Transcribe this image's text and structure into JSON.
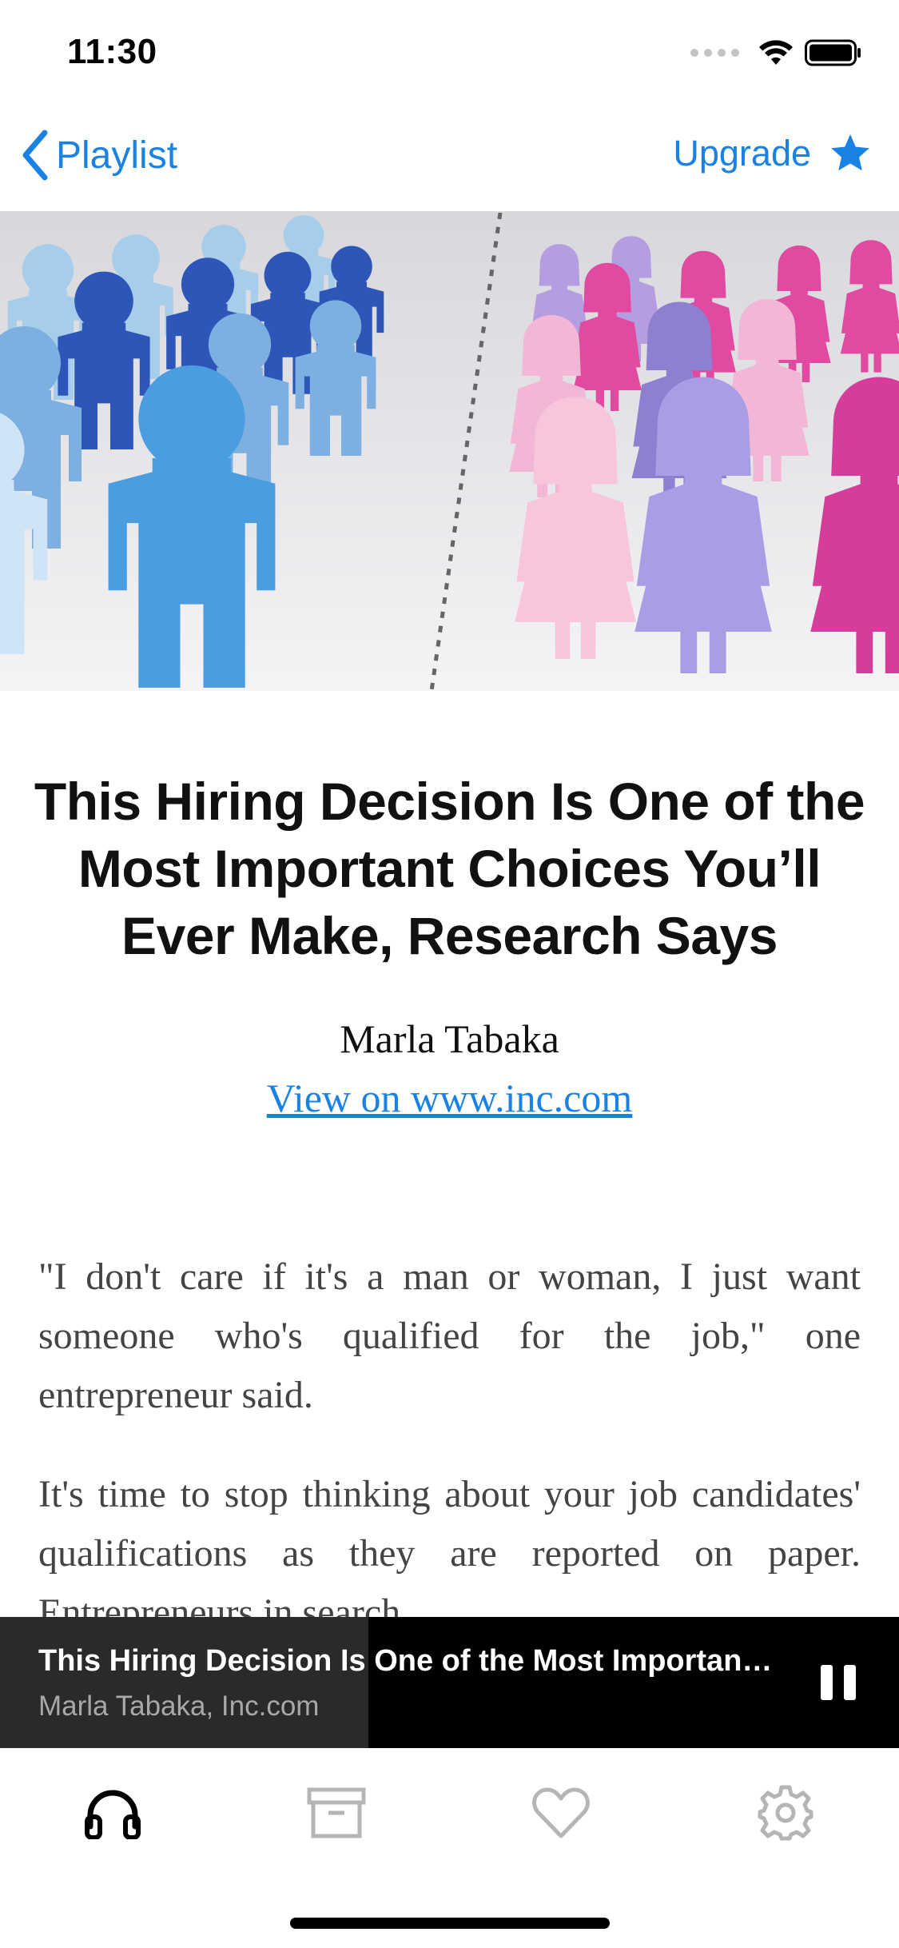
{
  "status_bar": {
    "time": "11:30"
  },
  "nav": {
    "back_label": "Playlist",
    "upgrade_label": "Upgrade"
  },
  "article": {
    "title": "This Hiring Decision Is One of the Most Important Choices You’ll Ever Make, Research Says",
    "author": "Marla Tabaka",
    "source_link": "View on www.inc.com",
    "paragraphs": [
      "\"I don't care if it's a man or woman, I just want someone who's qualified for the job,\" one entrepreneur said.",
      "It's time to stop thinking about your job candidates' qualifications as they are reported on paper. Entrepreneurs in search"
    ]
  },
  "mini_player": {
    "title": "This Hiring Decision Is One of the Most Important Choices You’ll Ever Make, Research Says",
    "subtitle": "Marla Tabaka, Inc.com",
    "progress": 0.41
  },
  "tabs": [
    {
      "icon": "headphones-icon",
      "active": true
    },
    {
      "icon": "archive-icon",
      "active": false
    },
    {
      "icon": "heart-icon",
      "active": false
    },
    {
      "icon": "gear-icon",
      "active": false
    }
  ],
  "colors": {
    "accent": "#1a82e2",
    "player_bg": "#000000",
    "tab_inactive": "#b5b5b5"
  }
}
